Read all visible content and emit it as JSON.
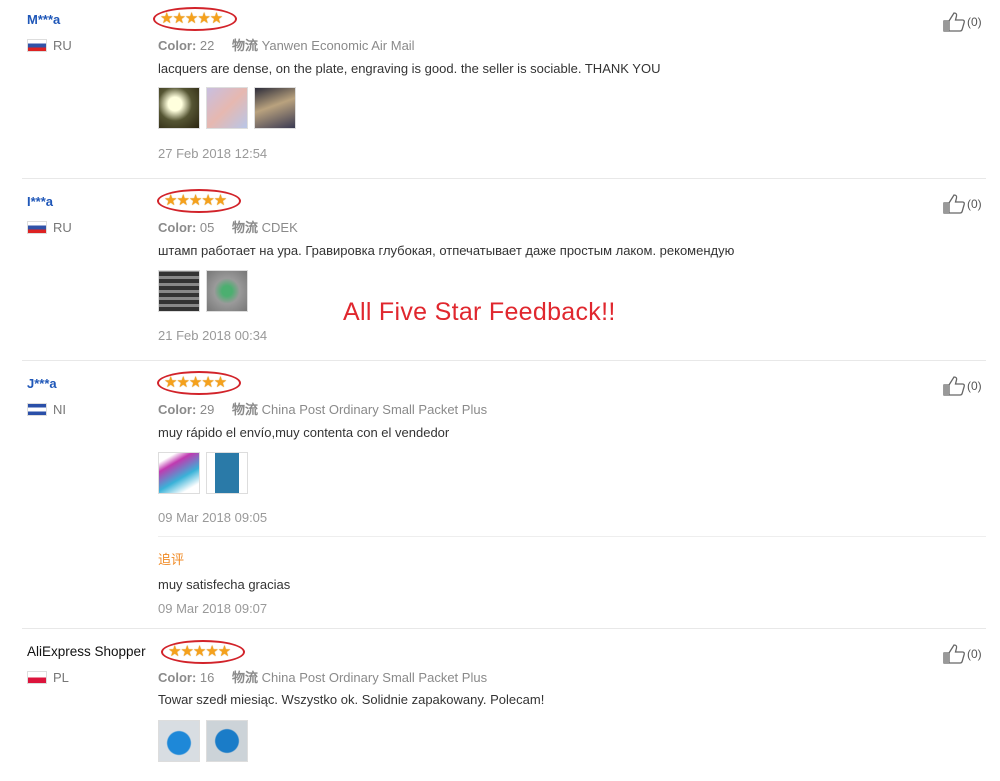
{
  "promo_text": "All Five Star Feedback!!",
  "reviews": [
    {
      "user": "M***a",
      "country": "RU",
      "stars": "★★★★★",
      "color_label": "Color:",
      "color_value": "22",
      "ship_label": "物流",
      "ship_value": "Yanwen Economic Air Mail",
      "text": "lacquers are dense, on the plate, engraving is good. the seller is sociable. THANK YOU",
      "date": "27 Feb 2018 12:54",
      "helpful": "(0)"
    },
    {
      "user": "I***a",
      "country": "RU",
      "stars": "★★★★★",
      "color_label": "Color:",
      "color_value": "05",
      "ship_label": "物流",
      "ship_value": "CDEK",
      "text": "штамп работает на ура. Гравировка глубокая, отпечатывает даже простым лаком. рекомендую",
      "date": "21 Feb 2018 00:34",
      "helpful": "(0)"
    },
    {
      "user": "J***a",
      "country": "NI",
      "stars": "★★★★★",
      "color_label": "Color:",
      "color_value": "29",
      "ship_label": "物流",
      "ship_value": "China Post Ordinary Small Packet Plus",
      "text": "muy rápido el envío,muy contenta con el vendedor",
      "date": "09 Mar 2018 09:05",
      "followup_label": "追评",
      "followup_text": "muy satisfecha gracias",
      "followup_date": "09 Mar 2018 09:07",
      "helpful": "(0)"
    },
    {
      "user": "AliExpress Shopper",
      "country": "PL",
      "stars": "★★★★★",
      "color_label": "Color:",
      "color_value": "16",
      "ship_label": "物流",
      "ship_value": "China Post Ordinary Small Packet Plus",
      "text": "Towar szedł miesiąc. Wszystko ok. Solidnie zapakowany. Polecam!",
      "helpful": "(0)"
    }
  ],
  "colors": {
    "accent": "#d2232a",
    "star": "#f5a11c",
    "username": "#1f57b8",
    "followup": "#f08a24"
  },
  "icons": {
    "helpful": "thumbs-up-icon"
  }
}
